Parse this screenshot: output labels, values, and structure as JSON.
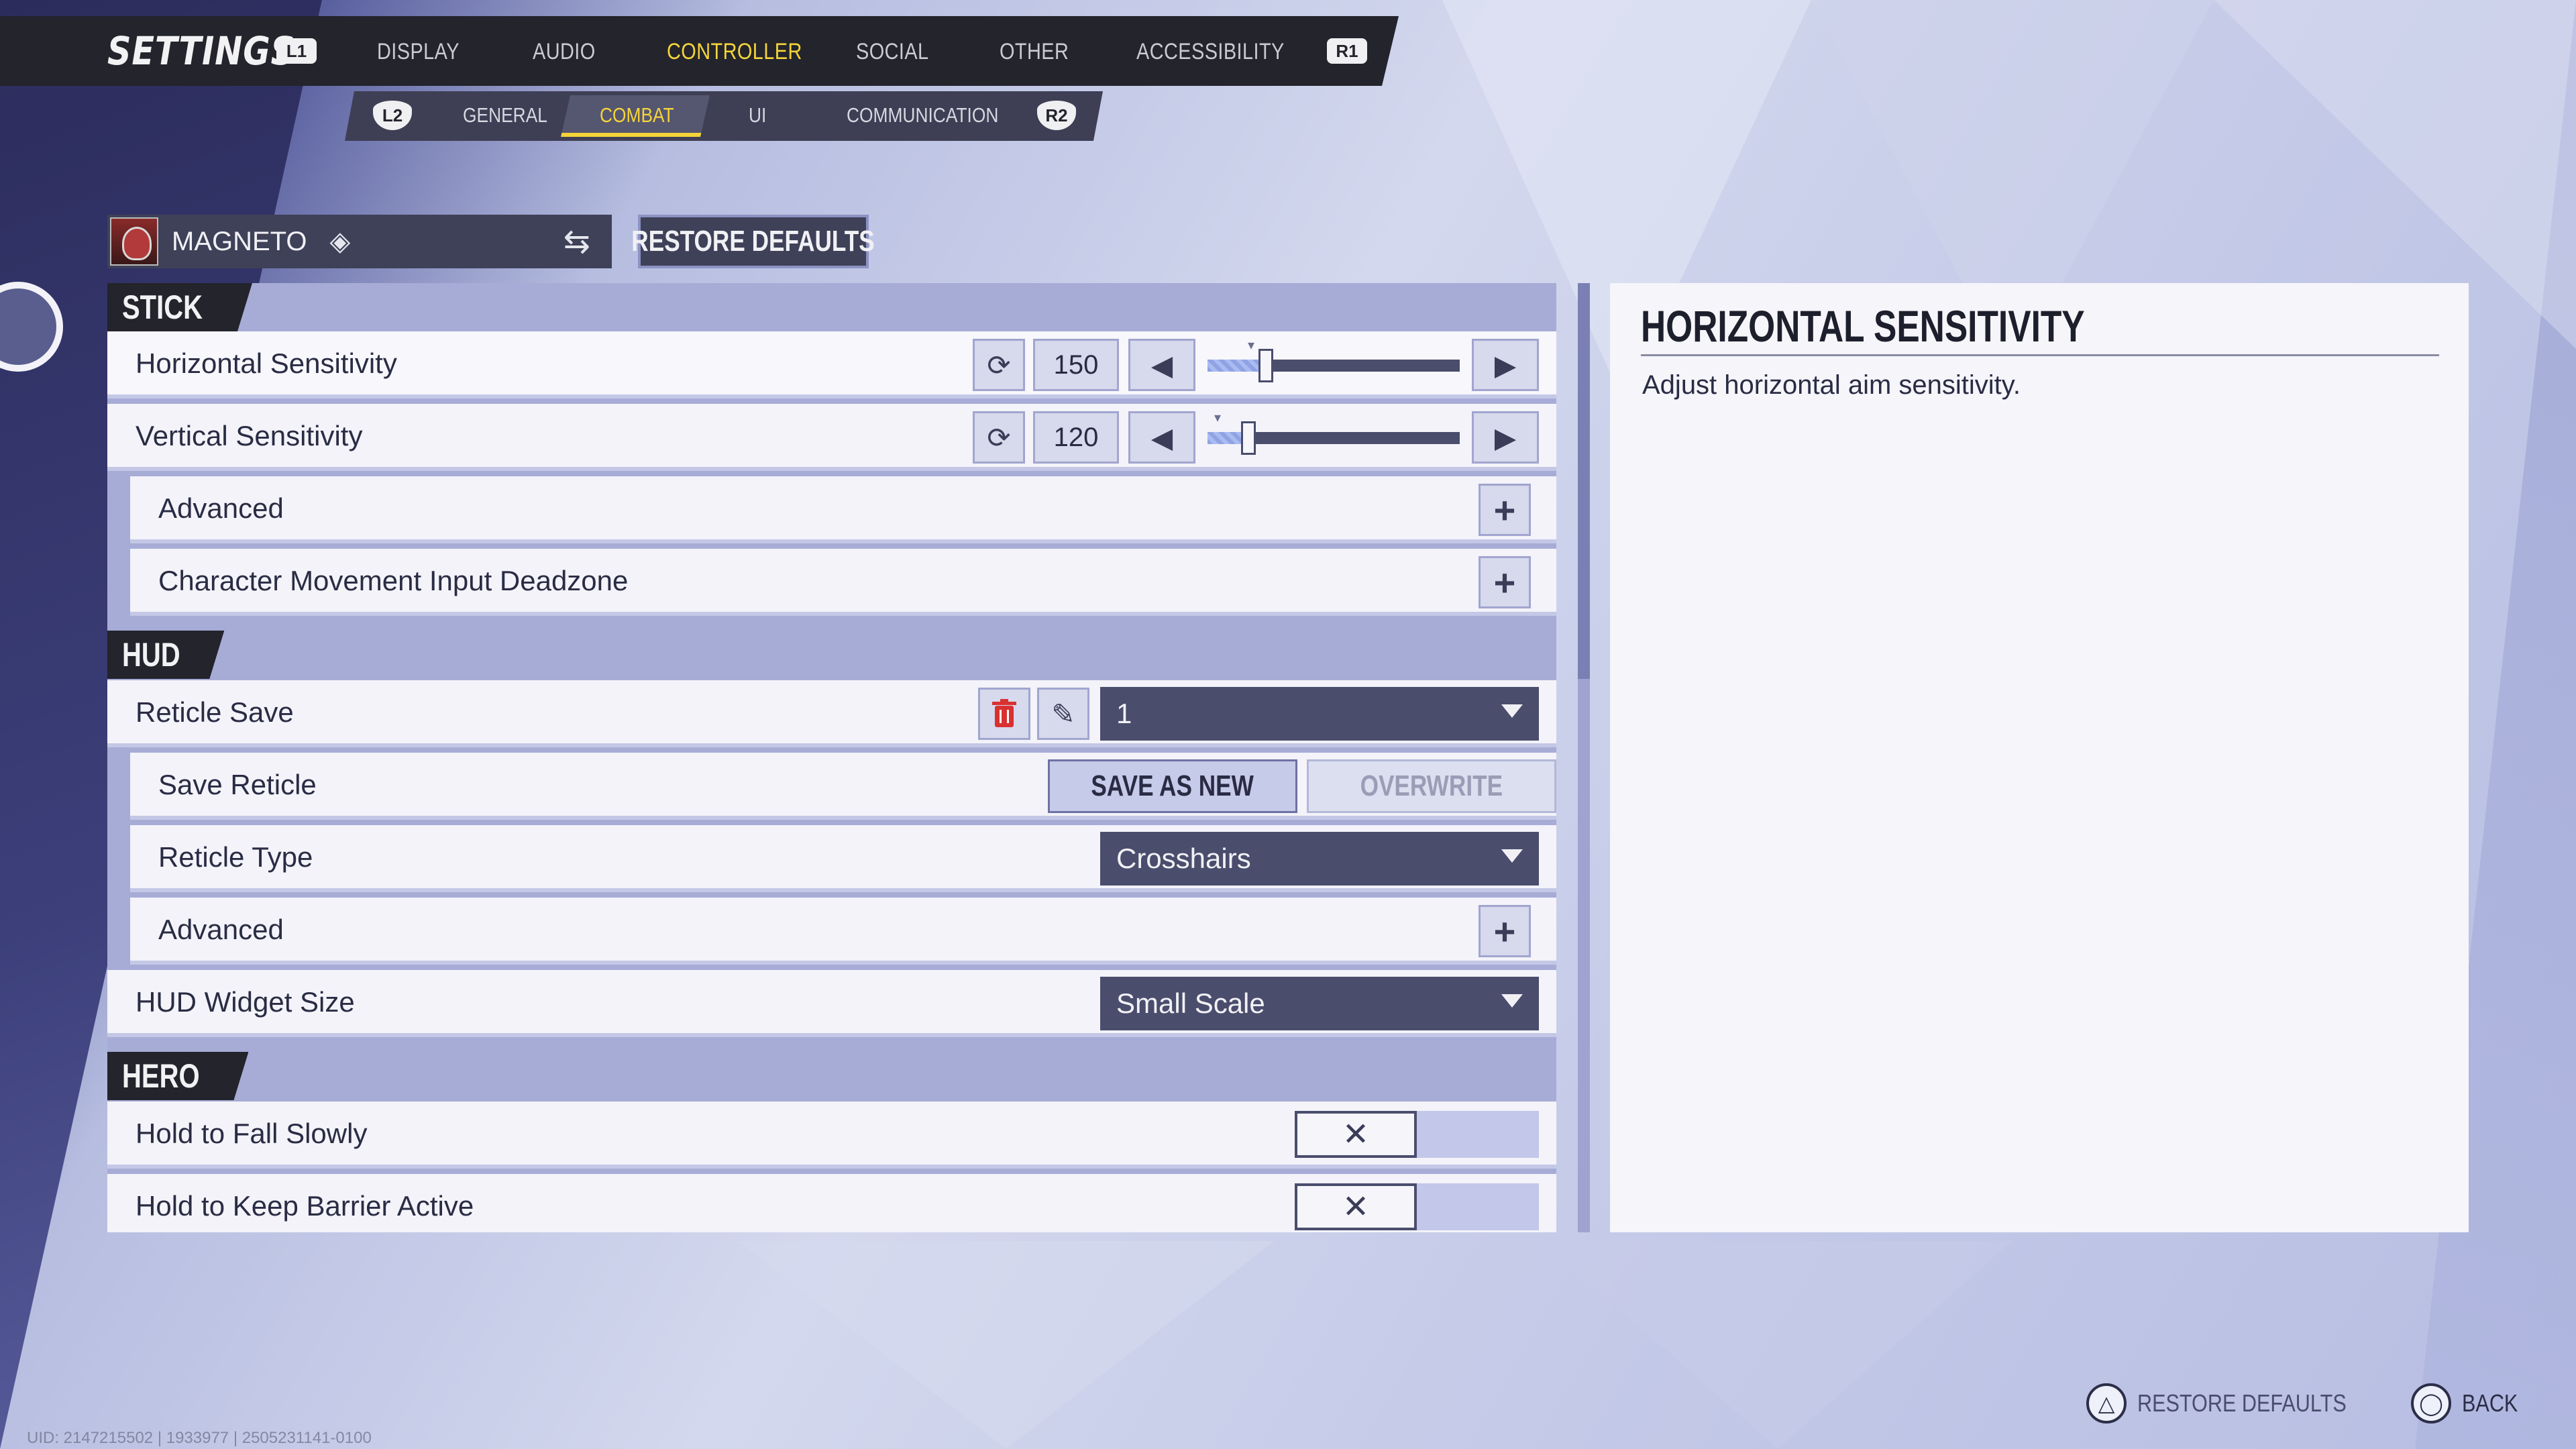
{
  "header": {
    "title": "SETTINGS",
    "left_bumper": "L1",
    "right_bumper": "R1",
    "tabs": [
      {
        "label": "DISPLAY",
        "active": false
      },
      {
        "label": "AUDIO",
        "active": false
      },
      {
        "label": "CONTROLLER",
        "active": true
      },
      {
        "label": "SOCIAL",
        "active": false
      },
      {
        "label": "OTHER",
        "active": false
      },
      {
        "label": "ACCESSIBILITY",
        "active": false
      }
    ]
  },
  "subnav": {
    "left_trigger": "L2",
    "right_trigger": "R2",
    "tabs": [
      {
        "label": "GENERAL",
        "active": false
      },
      {
        "label": "COMBAT",
        "active": true
      },
      {
        "label": "UI",
        "active": false
      },
      {
        "label": "COMMUNICATION",
        "active": false
      }
    ]
  },
  "hero_selector": {
    "name": "MAGNETO",
    "diamond_icon": "diamond-icon",
    "swap_icon": "swap-icon"
  },
  "restore_defaults_label": "RESTORE DEFAULTS",
  "sections": {
    "stick": {
      "label": "STICK"
    },
    "hud": {
      "label": "HUD"
    },
    "hero": {
      "label": "HERO"
    }
  },
  "rows": {
    "horizontal_sensitivity": {
      "label": "Horizontal Sensitivity",
      "value": "150",
      "level": 0.23
    },
    "vertical_sensitivity": {
      "label": "Vertical Sensitivity",
      "value": "120",
      "level": 0.16
    },
    "stick_advanced": {
      "label": "Advanced"
    },
    "deadzone": {
      "label": "Character Movement Input Deadzone"
    },
    "reticle_save": {
      "label": "Reticle Save",
      "selected": "1"
    },
    "save_reticle": {
      "label": "Save Reticle",
      "save_as_new": "SAVE AS NEW",
      "overwrite": "OVERWRITE"
    },
    "reticle_type": {
      "label": "Reticle Type",
      "selected": "Crosshairs"
    },
    "hud_advanced": {
      "label": "Advanced"
    },
    "hud_widget_size": {
      "label": "HUD Widget Size",
      "selected": "Small Scale"
    },
    "hold_fall_slowly": {
      "label": "Hold to Fall Slowly",
      "enabled": false
    },
    "hold_barrier": {
      "label": "Hold to Keep Barrier Active",
      "enabled": false
    }
  },
  "detail": {
    "title": "HORIZONTAL SENSITIVITY",
    "description": "Adjust horizontal aim sensitivity."
  },
  "footer": {
    "restore_label": "RESTORE DEFAULTS",
    "back_label": "BACK",
    "uid": "UID: 2147215502 | 1933977 | 2505231141-0100"
  },
  "colors": {
    "accent": "#f5d43a",
    "panel_dark": "#23242c",
    "slider_fill": "#8fa3e4",
    "delete_red": "#d93030"
  }
}
